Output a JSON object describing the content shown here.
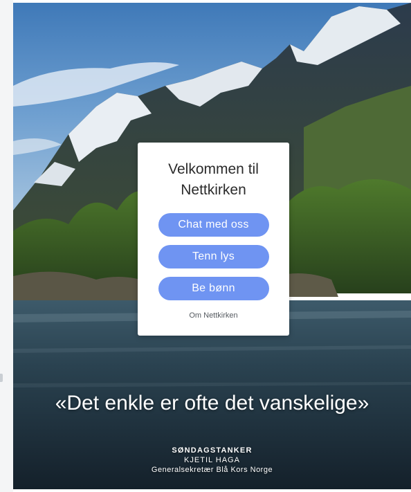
{
  "welcome": {
    "title": "Velkommen til Nettkirken",
    "buttons": {
      "chat": "Chat med oss",
      "light": "Tenn lys",
      "pray": "Be bønn"
    },
    "about_link": "Om Nettkirken"
  },
  "quote": {
    "text": "«Det enkle er ofte det vanskelige»",
    "series": "SØNDAGSTANKER",
    "author": "KJETIL HAGA",
    "role": "Generalsekretær Blå Kors Norge"
  },
  "colors": {
    "button": "#6f94f2",
    "card": "#ffffff",
    "text_dark": "#2b2b2b"
  }
}
